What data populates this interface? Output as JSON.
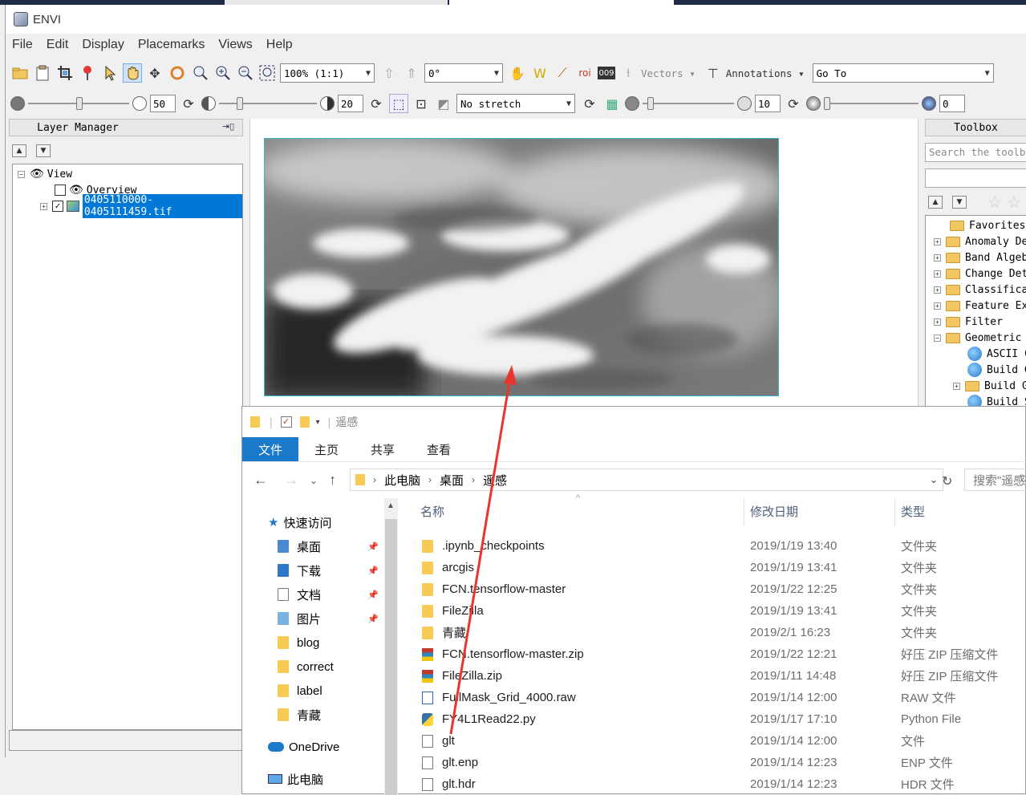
{
  "app": {
    "title": "ENVI"
  },
  "menu": [
    "File",
    "Edit",
    "Display",
    "Placemarks",
    "Views",
    "Help"
  ],
  "toolbar1": {
    "zoom": "100% (1:1)",
    "rotation": "0°",
    "vectors": "Vectors",
    "annotations": "Annotations",
    "goto_placeholder": "Go To"
  },
  "toolbar2": {
    "brightness": "50",
    "contrast": "20",
    "stretch": "No stretch",
    "sharpen": "10",
    "transparency": "0"
  },
  "layer_manager": {
    "title": "Layer Manager",
    "view_label": "View",
    "overview_label": "Overview",
    "file_label": "0405110000-0405111459.tif"
  },
  "toolbox": {
    "title": "Toolbox",
    "search_placeholder": "Search the toolbox",
    "items": [
      "Favorites",
      "Anomaly Detection",
      "Band Algebra",
      "Change Detection",
      "Classification",
      "Feature Extraction",
      "Filter",
      "Geometric Correction",
      "ASCII Coordinate",
      "Build GLT",
      "Build Geometry",
      "Build Super GLT"
    ]
  },
  "explorer": {
    "title": "遥感",
    "tabs": [
      "文件",
      "主页",
      "共享",
      "查看"
    ],
    "breadcrumb": [
      "此电脑",
      "桌面",
      "遥感"
    ],
    "search_placeholder": "搜索\"遥感\"",
    "nav": {
      "quick_access": "快速访问",
      "items": [
        "桌面",
        "下载",
        "文档",
        "图片",
        "blog",
        "correct",
        "label",
        "青藏"
      ],
      "onedrive": "OneDrive",
      "this_pc": "此电脑"
    },
    "columns": {
      "name": "名称",
      "date": "修改日期",
      "type": "类型"
    },
    "files": [
      {
        "name": ".ipynb_checkpoints",
        "date": "2019/1/19 13:40",
        "type": "文件夹",
        "icon": "folder-icon"
      },
      {
        "name": "arcgis",
        "date": "2019/1/19 13:41",
        "type": "文件夹",
        "icon": "folder-icon"
      },
      {
        "name": "FCN.tensorflow-master",
        "date": "2019/1/22 12:25",
        "type": "文件夹",
        "icon": "folder-icon"
      },
      {
        "name": "FileZilla",
        "date": "2019/1/19 13:41",
        "type": "文件夹",
        "icon": "folder-icon"
      },
      {
        "name": "青藏",
        "date": "2019/2/1 16:23",
        "type": "文件夹",
        "icon": "folder-icon"
      },
      {
        "name": "FCN.tensorflow-master.zip",
        "date": "2019/1/22 12:21",
        "type": "好压 ZIP 压缩文件",
        "icon": "zip-icon"
      },
      {
        "name": "FileZilla.zip",
        "date": "2019/1/11 14:48",
        "type": "好压 ZIP 压缩文件",
        "icon": "zip-icon"
      },
      {
        "name": "FullMask_Grid_4000.raw",
        "date": "2019/1/14 12:00",
        "type": "RAW 文件",
        "icon": "raw-file-icon"
      },
      {
        "name": "FY4L1Read22.py",
        "date": "2019/1/17 17:10",
        "type": "Python File",
        "icon": "python-file-icon"
      },
      {
        "name": "glt",
        "date": "2019/1/14 12:00",
        "type": "文件",
        "icon": "file-icon"
      },
      {
        "name": "glt.enp",
        "date": "2019/1/14 12:23",
        "type": "ENP 文件",
        "icon": "file-icon"
      },
      {
        "name": "glt.hdr",
        "date": "2019/1/14 12:23",
        "type": "HDR 文件",
        "icon": "file-icon"
      }
    ]
  },
  "colors": {
    "accent": "#1979ca",
    "selection": "#0078d7",
    "annotation_arrow": "#e8362f",
    "image_border": "#35b7c6"
  }
}
